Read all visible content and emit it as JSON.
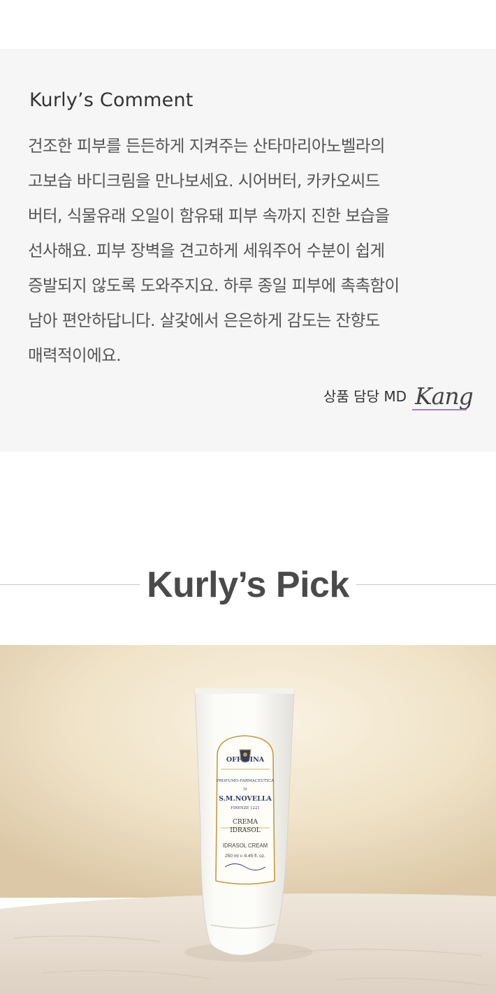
{
  "comment": {
    "heading": "Kurly’s Comment",
    "lines": [
      "건조한 피부를 든든하게 지켜주는 산타마리아노벨라의",
      "고보습 바디크림을 만나보세요. 시어버터, 카카오씨드",
      "버터, 식물유래 오일이 함유돼 피부 속까지 진한 보습을",
      "선사해요. 피부 장벽을 견고하게 세워주어 수분이 쉽게",
      "증발되지 않도록 도와주지요. 하루 종일 피부에 촉촉함이",
      "남아 편안하답니다. 살갗에서 은은하게 감도는 잔향도",
      "매력적이에요."
    ],
    "signature_label": "상품 담당 MD",
    "signature_name": "Kang",
    "signature_underline_color": "#a580c8"
  },
  "pick": {
    "title": "Kurly’s Pick"
  },
  "product_label": {
    "brand_top": "OFFICINA",
    "brand_arc": "PROFUMO-FARMACEUTICA",
    "brand_di": "DI",
    "brand_name": "S.M.NOVELLA",
    "brand_city": "FIRENZE 1221",
    "product_line1": "CREMA",
    "product_line2": "IDRASOL",
    "product_en": "IDRASOL CREAM",
    "volume": "250 ml ℮ 8.45 fl. oz."
  }
}
